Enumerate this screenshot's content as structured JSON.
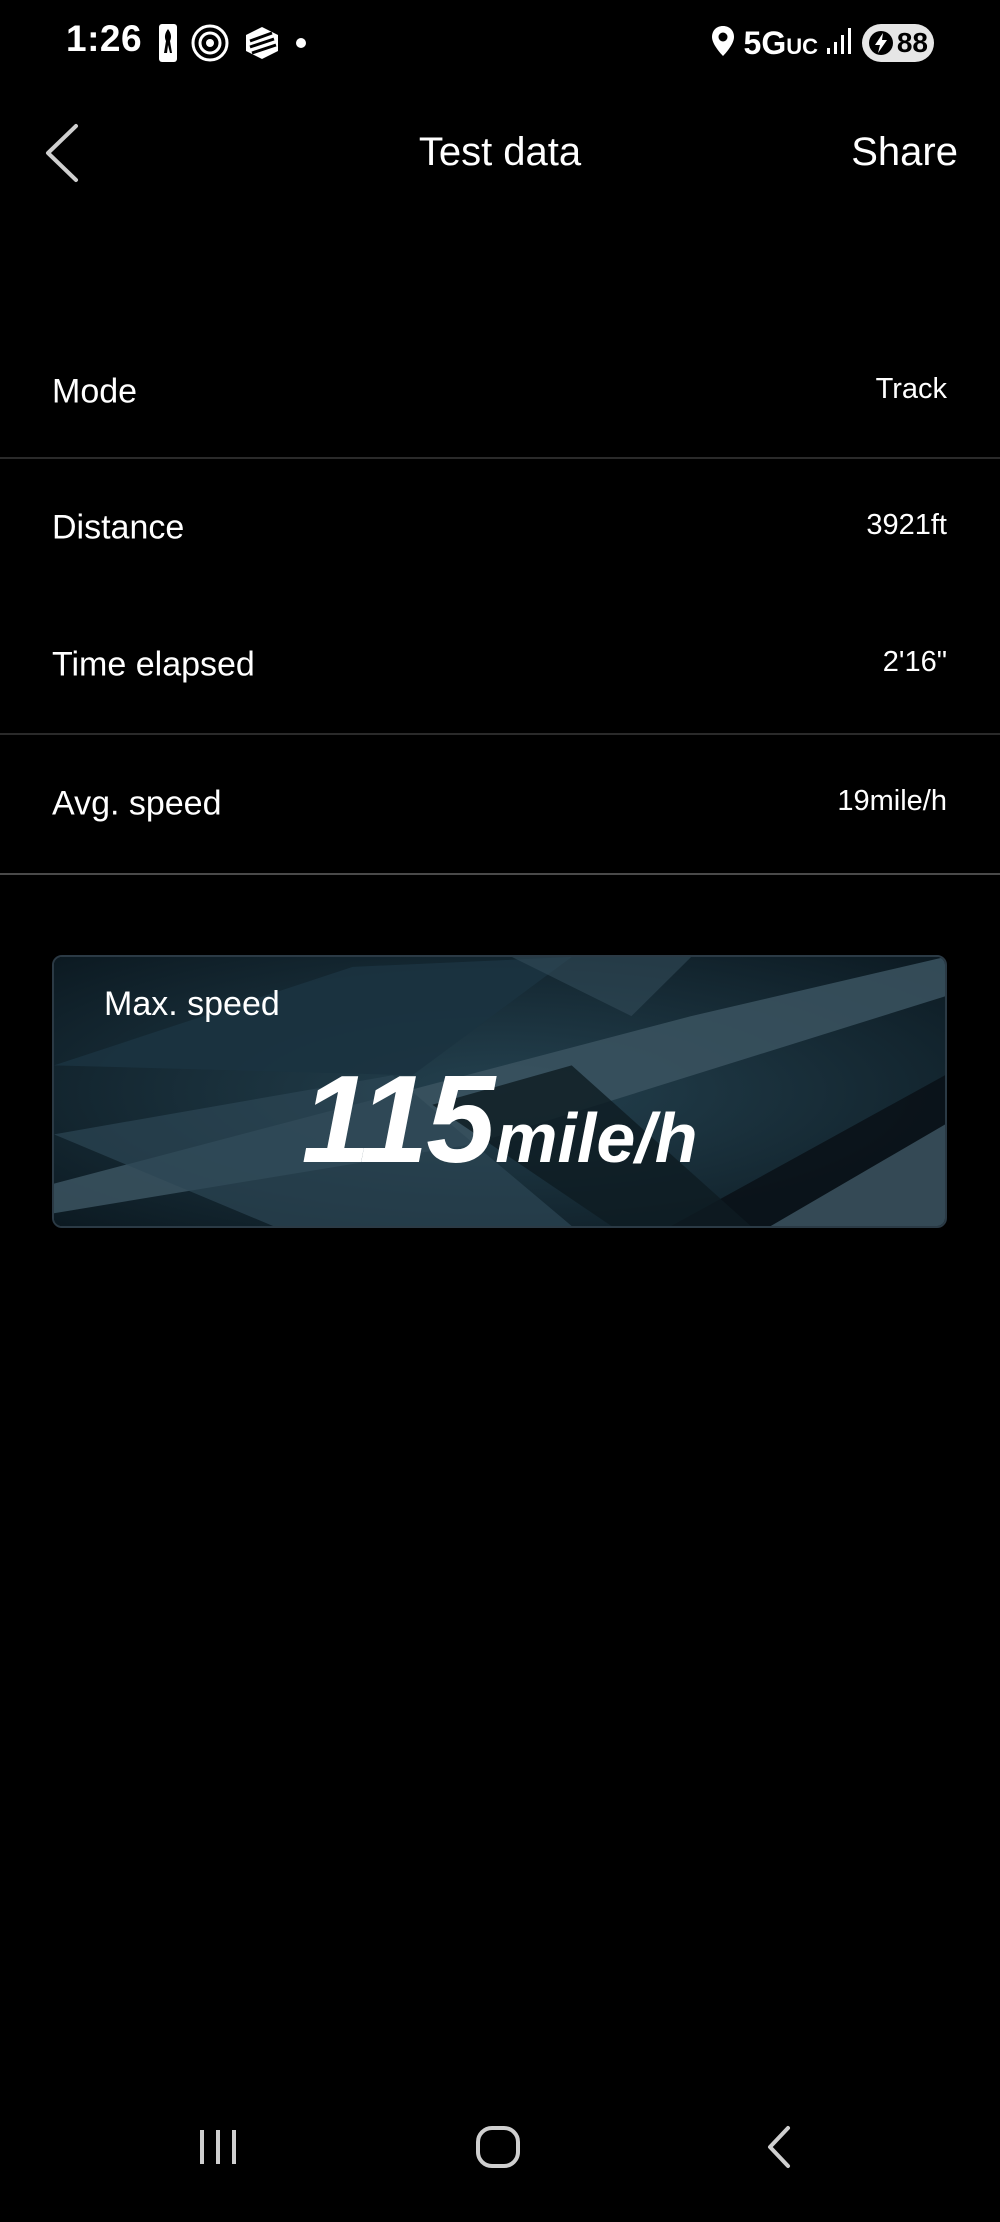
{
  "status_bar": {
    "time": "1:26",
    "network": "5G",
    "network_suffix": "UC",
    "battery": "88",
    "icons": [
      "nba-icon",
      "threads-icon",
      "cube-app-icon",
      "notification-dot-icon",
      "location-icon",
      "signal-icon",
      "battery-charging-icon"
    ]
  },
  "header": {
    "title": "Test data",
    "share_label": "Share",
    "back_icon": "chevron-left-icon"
  },
  "rows": [
    {
      "label": "Mode",
      "value": "Track"
    },
    {
      "label": "Distance",
      "value": "3921ft"
    },
    {
      "label": "Time elapsed",
      "value": "2'16\""
    },
    {
      "label": "Avg. speed",
      "value": "19mile/h"
    }
  ],
  "max_speed": {
    "label": "Max. speed",
    "value": "115",
    "unit": "mile/h"
  },
  "nav_bar": {
    "icons": [
      "recent-apps-icon",
      "home-icon",
      "back-icon"
    ]
  },
  "colors": {
    "background": "#000000",
    "text": "#ffffff",
    "divider": "#2a2a2a",
    "card_accent": "#1e3a4a"
  }
}
